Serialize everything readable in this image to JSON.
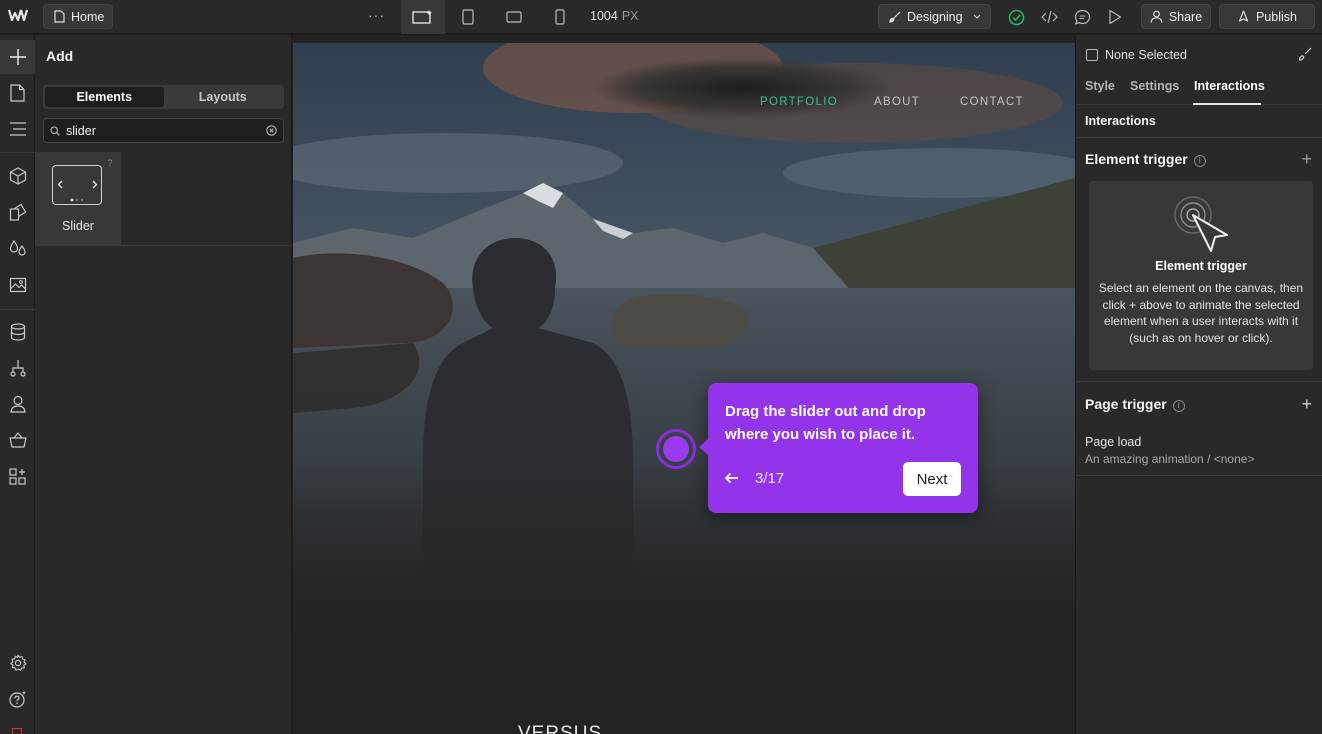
{
  "topbar": {
    "logo": "W",
    "page": "Home",
    "more": "···",
    "width_value": "1004",
    "width_unit": "PX",
    "mode": "Designing",
    "share": "Share",
    "publish": "Publish"
  },
  "left_panel": {
    "title": "Add",
    "tabs": [
      "Elements",
      "Layouts"
    ],
    "active_tab": "Elements",
    "search_value": "slider",
    "results": [
      {
        "label": "Slider",
        "help": "?"
      }
    ]
  },
  "canvas": {
    "nav": [
      "PORTFOLIO",
      "ABOUT",
      "CONTACT"
    ],
    "active_nav": "PORTFOLIO",
    "versus": "VERSUS",
    "tour": {
      "text": "Drag the slider out and drop where you wish to place it.",
      "step": "3/17",
      "next": "Next"
    }
  },
  "right_panel": {
    "selection": "None Selected",
    "tabs": [
      "Style",
      "Settings",
      "Interactions"
    ],
    "active_tab": "Interactions",
    "section": "Interactions",
    "element_trigger": {
      "title": "Element trigger",
      "card_title": "Element trigger",
      "card_text": "Select an element on the canvas, then click + above to animate the selected element when a user interacts with it (such as on hover or click)."
    },
    "page_trigger": {
      "title": "Page trigger",
      "item_label": "Page load",
      "item_sub": "An amazing animation / <none>"
    }
  },
  "colors": {
    "accent_purple": "#9333ea",
    "nav_active": "#33c0a0",
    "status_ok": "#2fb760"
  }
}
